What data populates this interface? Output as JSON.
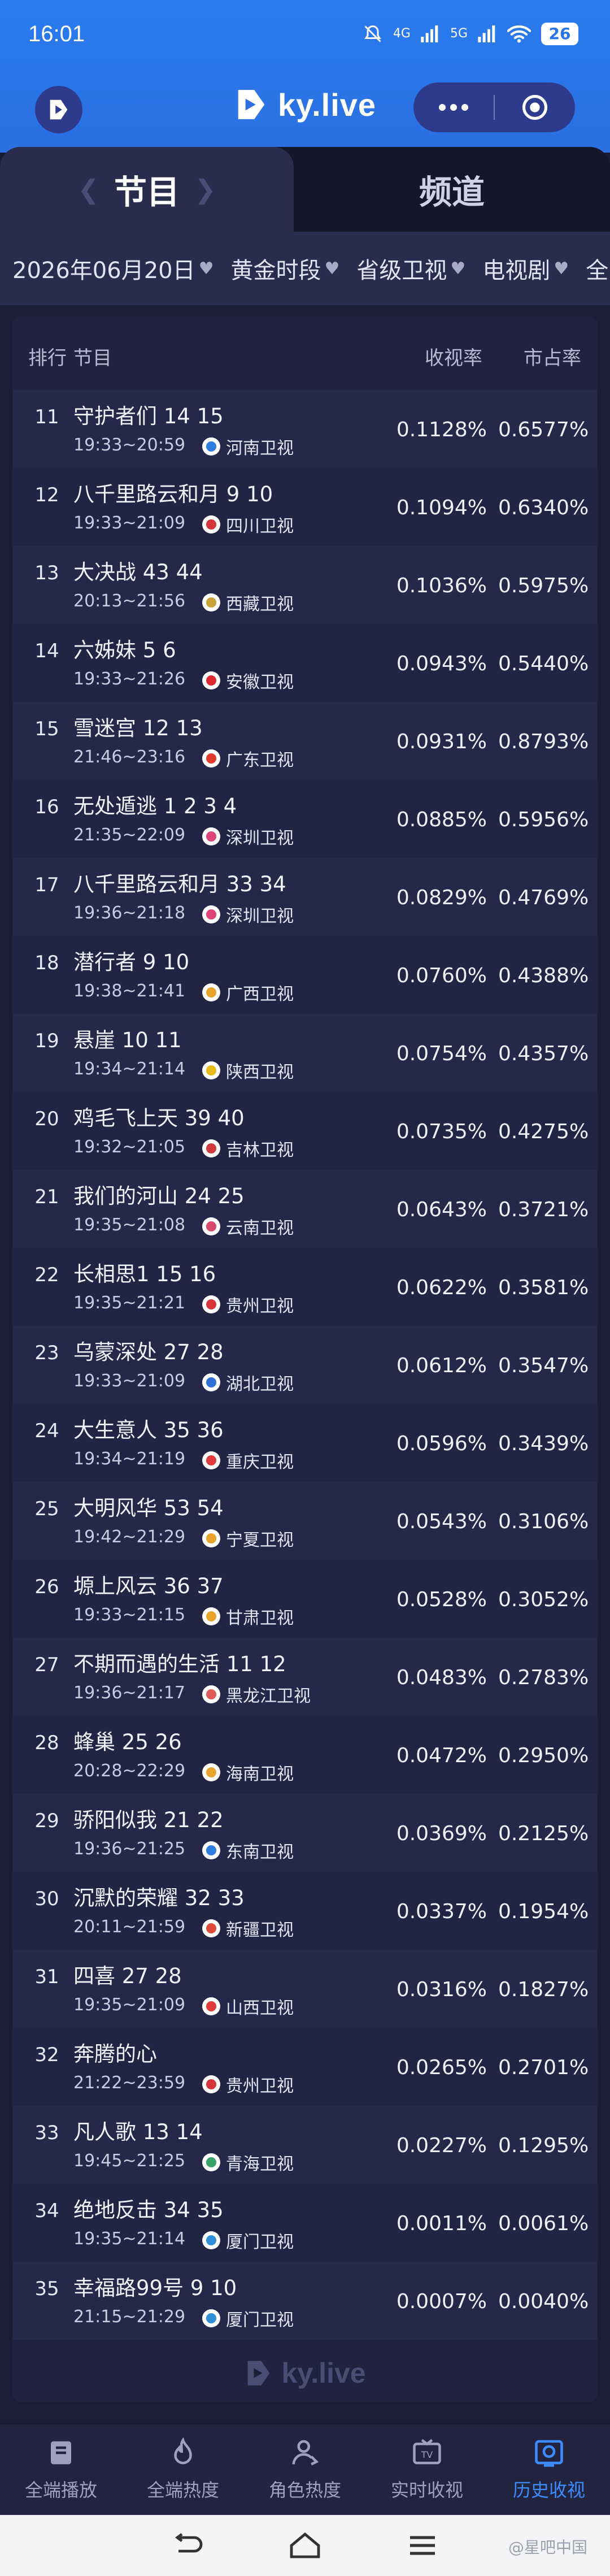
{
  "status": {
    "time": "16:01",
    "net_top": "4G",
    "net_bottom": "5G",
    "battery": "26"
  },
  "app": {
    "logo_text": "ky.live"
  },
  "tabs": [
    {
      "label": "节目"
    },
    {
      "label": "频道"
    }
  ],
  "filters": [
    {
      "label": "2026年06月20日"
    },
    {
      "label": "黄金时段"
    },
    {
      "label": "省级卫视"
    },
    {
      "label": "电视剧"
    },
    {
      "label": "全国"
    }
  ],
  "table": {
    "headers": {
      "rank": "排行",
      "program": "节目",
      "rating": "收视率",
      "share": "市占率"
    },
    "rows": [
      {
        "rank": "11",
        "title": "守护者们 14 15",
        "time": "19:33~20:59",
        "channel": "河南卫视",
        "rating": "0.1128%",
        "share": "0.6577%"
      },
      {
        "rank": "12",
        "title": "八千里路云和月 9 10",
        "time": "19:33~21:09",
        "channel": "四川卫视",
        "rating": "0.1094%",
        "share": "0.6340%"
      },
      {
        "rank": "13",
        "title": "大决战 43 44",
        "time": "20:13~21:56",
        "channel": "西藏卫视",
        "rating": "0.1036%",
        "share": "0.5975%"
      },
      {
        "rank": "14",
        "title": "六姊妹 5 6",
        "time": "19:33~21:26",
        "channel": "安徽卫视",
        "rating": "0.0943%",
        "share": "0.5440%"
      },
      {
        "rank": "15",
        "title": "雪迷宫 12 13",
        "time": "21:46~23:16",
        "channel": "广东卫视",
        "rating": "0.0931%",
        "share": "0.8793%"
      },
      {
        "rank": "16",
        "title": "无处遁逃 1 2 3 4",
        "time": "21:35~22:09",
        "channel": "深圳卫视",
        "rating": "0.0885%",
        "share": "0.5956%"
      },
      {
        "rank": "17",
        "title": "八千里路云和月 33 34",
        "time": "19:36~21:18",
        "channel": "深圳卫视",
        "rating": "0.0829%",
        "share": "0.4769%"
      },
      {
        "rank": "18",
        "title": "潜行者 9 10",
        "time": "19:38~21:41",
        "channel": "广西卫视",
        "rating": "0.0760%",
        "share": "0.4388%"
      },
      {
        "rank": "19",
        "title": "悬崖 10 11",
        "time": "19:34~21:14",
        "channel": "陕西卫视",
        "rating": "0.0754%",
        "share": "0.4357%"
      },
      {
        "rank": "20",
        "title": "鸡毛飞上天 39 40",
        "time": "19:32~21:05",
        "channel": "吉林卫视",
        "rating": "0.0735%",
        "share": "0.4275%"
      },
      {
        "rank": "21",
        "title": "我们的河山 24 25",
        "time": "19:35~21:08",
        "channel": "云南卫视",
        "rating": "0.0643%",
        "share": "0.3721%"
      },
      {
        "rank": "22",
        "title": "长相思1 15 16",
        "time": "19:35~21:21",
        "channel": "贵州卫视",
        "rating": "0.0622%",
        "share": "0.3581%"
      },
      {
        "rank": "23",
        "title": "乌蒙深处 27 28",
        "time": "19:33~21:09",
        "channel": "湖北卫视",
        "rating": "0.0612%",
        "share": "0.3547%"
      },
      {
        "rank": "24",
        "title": "大生意人 35 36",
        "time": "19:34~21:19",
        "channel": "重庆卫视",
        "rating": "0.0596%",
        "share": "0.3439%"
      },
      {
        "rank": "25",
        "title": "大明风华 53 54",
        "time": "19:42~21:29",
        "channel": "宁夏卫视",
        "rating": "0.0543%",
        "share": "0.3106%"
      },
      {
        "rank": "26",
        "title": "塬上风云 36 37",
        "time": "19:33~21:15",
        "channel": "甘肃卫视",
        "rating": "0.0528%",
        "share": "0.3052%"
      },
      {
        "rank": "27",
        "title": "不期而遇的生活 11 12",
        "time": "19:36~21:17",
        "channel": "黑龙江卫视",
        "rating": "0.0483%",
        "share": "0.2783%"
      },
      {
        "rank": "28",
        "title": "蜂巢 25 26",
        "time": "20:28~22:29",
        "channel": "海南卫视",
        "rating": "0.0472%",
        "share": "0.2950%"
      },
      {
        "rank": "29",
        "title": "骄阳似我 21 22",
        "time": "19:36~21:25",
        "channel": "东南卫视",
        "rating": "0.0369%",
        "share": "0.2125%"
      },
      {
        "rank": "30",
        "title": "沉默的荣耀 32 33",
        "time": "20:11~21:59",
        "channel": "新疆卫视",
        "rating": "0.0337%",
        "share": "0.1954%"
      },
      {
        "rank": "31",
        "title": "四喜 27 28",
        "time": "19:35~21:09",
        "channel": "山西卫视",
        "rating": "0.0316%",
        "share": "0.1827%"
      },
      {
        "rank": "32",
        "title": "奔腾的心",
        "time": "21:22~23:59",
        "channel": "贵州卫视",
        "rating": "0.0265%",
        "share": "0.2701%"
      },
      {
        "rank": "33",
        "title": "凡人歌 13 14",
        "time": "19:45~21:25",
        "channel": "青海卫视",
        "rating": "0.0227%",
        "share": "0.1295%"
      },
      {
        "rank": "34",
        "title": "绝地反击 34 35",
        "time": "19:35~21:14",
        "channel": "厦门卫视",
        "rating": "0.0011%",
        "share": "0.0061%"
      },
      {
        "rank": "35",
        "title": "幸福路99号 9 10",
        "time": "21:15~21:29",
        "channel": "厦门卫视",
        "rating": "0.0007%",
        "share": "0.0040%"
      }
    ]
  },
  "channel_colors": {
    "河南卫视": "#2f7de1",
    "四川卫视": "#d8343a",
    "西藏卫视": "#c9a23a",
    "安徽卫视": "#e0282f",
    "广东卫视": "#e33a2e",
    "深圳卫视": "#e0427a",
    "广西卫视": "#e8a32a",
    "陕西卫视": "#e8b91a",
    "吉林卫视": "#d23a3a",
    "云南卫视": "#d84a6a",
    "贵州卫视": "#d8343a",
    "湖北卫视": "#2f6fd8",
    "重庆卫视": "#e03a3a",
    "宁夏卫视": "#e8a32a",
    "甘肃卫视": "#e6a52a",
    "黑龙江卫视": "#e05a5a",
    "海南卫视": "#e8a32a",
    "东南卫视": "#2f7de1",
    "新疆卫视": "#e04a3a",
    "山西卫视": "#e03a3a",
    "青海卫视": "#3aa36a",
    "厦门卫视": "#2f8fd8"
  },
  "watermark": "ky.live",
  "bottom_nav": [
    {
      "label": "全端播放",
      "icon": "book-icon",
      "active": false
    },
    {
      "label": "全端热度",
      "icon": "flame-icon",
      "active": false
    },
    {
      "label": "角色热度",
      "icon": "person-icon",
      "active": false
    },
    {
      "label": "实时收视",
      "icon": "tv-icon",
      "active": false
    },
    {
      "label": "历史收视",
      "icon": "history-icon",
      "active": true
    }
  ],
  "weibo_mark": "@星吧中国"
}
